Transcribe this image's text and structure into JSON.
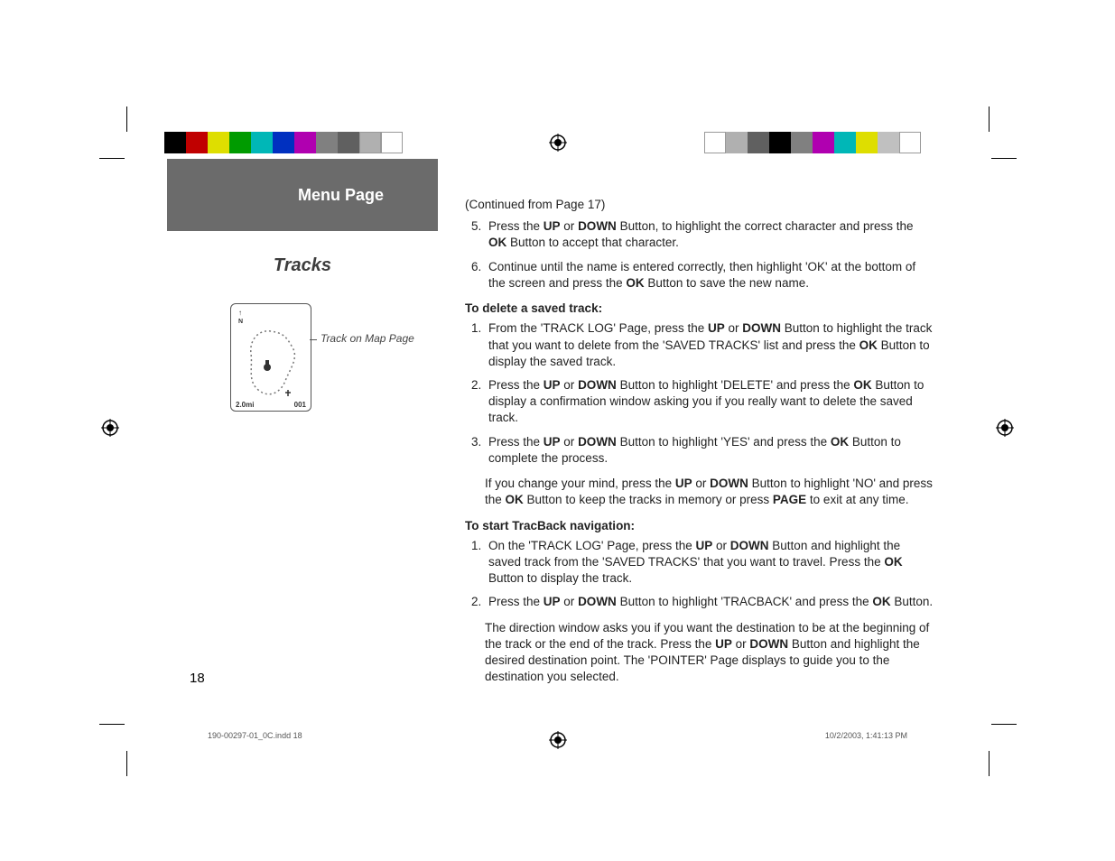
{
  "left": {
    "banner": "Menu Page",
    "section": "Tracks",
    "figure": {
      "scale": "2.0mi",
      "wpt": "001",
      "n": "N"
    },
    "callout": "Track on Map Page",
    "pagenum": "18"
  },
  "body": {
    "cont": "(Continued from Page 17)",
    "list1": {
      "i5_a": "Press the ",
      "i5_b": "UP",
      "i5_c": " or ",
      "i5_d": "DOWN",
      "i5_e": " Button, to highlight the correct character and press the ",
      "i5_f": "OK",
      "i5_g": " Button to accept that character.",
      "i6_a": "Continue until the name is entered correctly, then highlight 'OK' at the bottom of the screen and press the ",
      "i6_b": "OK",
      "i6_c": " Button to save the new name."
    },
    "h_delete": "To delete a saved track:",
    "list2": {
      "i1_a": "From the 'TRACK LOG' Page, press the ",
      "i1_b": "UP",
      "i1_c": " or ",
      "i1_d": "DOWN",
      "i1_e": " Button to highlight the track that you want to delete from the 'SAVED TRACKS' list and press the ",
      "i1_f": "OK",
      "i1_g": " Button to display the saved track.",
      "i2_a": "Press the ",
      "i2_b": "UP",
      "i2_c": " or ",
      "i2_d": "DOWN",
      "i2_e": " Button to highlight 'DELETE' and press the ",
      "i2_f": "OK",
      "i2_g": " Button to display a confirmation window asking you if you really want to delete the saved track.",
      "i3_a": "Press the ",
      "i3_b": "UP",
      "i3_c": " or ",
      "i3_d": "DOWN",
      "i3_e": " Button to highlight 'YES' and press the ",
      "i3_f": "OK",
      "i3_g": " Button to complete the process."
    },
    "para_no_a": "If you change your mind, press the ",
    "para_no_b": "UP",
    "para_no_c": " or ",
    "para_no_d": "DOWN",
    "para_no_e": " Button to highlight 'NO' and press the ",
    "para_no_f": "OK",
    "para_no_g": " Button to keep the tracks in memory or press ",
    "para_no_h": "PAGE",
    "para_no_i": " to exit at any time.",
    "h_tracback": "To start TracBack navigation:",
    "list3": {
      "i1_a": "On the 'TRACK LOG' Page, press the ",
      "i1_b": "UP",
      "i1_c": " or ",
      "i1_d": "DOWN",
      "i1_e": " Button and highlight the saved track from the 'SAVED TRACKS' that you want to travel. Press the ",
      "i1_f": "OK",
      "i1_g": " Button to display the track.",
      "i2_a": "Press the ",
      "i2_b": "UP",
      "i2_c": " or ",
      "i2_d": "DOWN",
      "i2_e": " Button to highlight 'TRACBACK' and press the ",
      "i2_f": "OK",
      "i2_g": " Button."
    },
    "para_dir_a": " The direction window asks you if you want the destination to be at the beginning of the track or the end of the track. Press the ",
    "para_dir_b": "UP",
    "para_dir_c": " or ",
    "para_dir_d": "DOWN",
    "para_dir_e": " Button and highlight the desired destination point. The 'POINTER' Page displays to guide you to the destination you selected."
  },
  "slug": {
    "left": "190-00297-01_0C.indd   18",
    "right": "10/2/2003, 1:41:13 PM"
  },
  "colorbar": {
    "left": [
      "#000000",
      "#c00000",
      "#dede00",
      "#009b00",
      "#00b7b7",
      "#0030c0",
      "#b000b0",
      "#808080",
      "#606060",
      "#b0b0b0",
      "#ffffff"
    ],
    "right": [
      "#ffffff",
      "#b0b0b0",
      "#606060",
      "#000000",
      "#808080",
      "#b000b0",
      "#00b7b7",
      "#dede00",
      "#c0c0c0",
      "#ffffff"
    ]
  }
}
